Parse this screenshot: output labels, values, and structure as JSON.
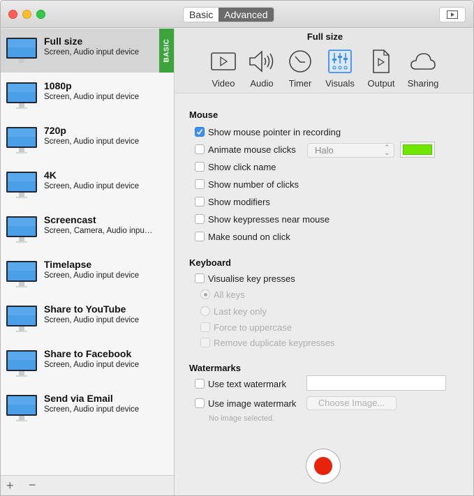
{
  "titlebar": {
    "segments": [
      "Basic",
      "Advanced"
    ],
    "selected_segment": "Advanced",
    "right_button_icon": "preview-play-icon"
  },
  "sidebar": {
    "presets": [
      {
        "name": "Full size",
        "sources": "Screen, Audio input device",
        "selected": true,
        "badge": "BASIC"
      },
      {
        "name": "1080p",
        "sources": "Screen, Audio input device"
      },
      {
        "name": "720p",
        "sources": "Screen, Audio input device"
      },
      {
        "name": "4K",
        "sources": "Screen, Audio input device"
      },
      {
        "name": "Screencast",
        "sources": "Screen, Camera, Audio inpu…"
      },
      {
        "name": "Timelapse",
        "sources": "Screen, Audio input device"
      },
      {
        "name": "Share to YouTube",
        "sources": "Screen, Audio input device"
      },
      {
        "name": "Share to Facebook",
        "sources": "Screen, Audio input device"
      },
      {
        "name": "Send via Email",
        "sources": "Screen, Audio input device"
      }
    ],
    "footer": {
      "add": "+",
      "remove": "−"
    }
  },
  "header": {
    "title": "Full size",
    "tabs": [
      {
        "label": "Video",
        "icon": "video-icon"
      },
      {
        "label": "Audio",
        "icon": "speaker-icon"
      },
      {
        "label": "Timer",
        "icon": "clock-icon"
      },
      {
        "label": "Visuals",
        "icon": "sliders-icon",
        "selected": true
      },
      {
        "label": "Output",
        "icon": "file-play-icon"
      },
      {
        "label": "Sharing",
        "icon": "cloud-icon"
      }
    ]
  },
  "mouse": {
    "title": "Mouse",
    "options": [
      {
        "label": "Show mouse pointer in recording",
        "checked": true
      },
      {
        "label": "Animate mouse clicks",
        "checked": false
      },
      {
        "label": "Show click name",
        "checked": false
      },
      {
        "label": "Show number of clicks",
        "checked": false
      },
      {
        "label": "Show modifiers",
        "checked": false
      },
      {
        "label": "Show keypresses near mouse",
        "checked": false
      },
      {
        "label": "Make sound on click",
        "checked": false
      }
    ],
    "animation_style": "Halo",
    "click_color": "#6ee600"
  },
  "keyboard": {
    "title": "Keyboard",
    "visualise_label": "Visualise key presses",
    "visualise_checked": false,
    "radio_options": [
      {
        "label": "All keys",
        "selected": true
      },
      {
        "label": "Last key only",
        "selected": false
      }
    ],
    "sub_options": [
      {
        "label": "Force to uppercase",
        "checked": false
      },
      {
        "label": "Remove duplicate keypresses",
        "checked": false
      }
    ]
  },
  "watermarks": {
    "title": "Watermarks",
    "text_label": "Use text watermark",
    "text_value": "",
    "image_label": "Use image watermark",
    "choose_label": "Choose Image...",
    "no_image": "No image selected."
  },
  "record_button": "record-icon"
}
